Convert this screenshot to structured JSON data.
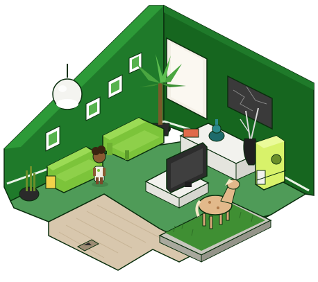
{
  "scene": {
    "type": "isometric-game-room",
    "theme": "green-walls-living-room",
    "colors": {
      "wall_left": "#1f7a2a",
      "wall_right": "#16661f",
      "wall_shadow": "#0f4d15",
      "wall_trim": "#2d9a38",
      "floor_carpet": "#4f9b58",
      "floor_wood": "#d8c7ad",
      "outline": "#0a2f0e",
      "sofa": "#7cc43a",
      "lamp": "#f4f4f0",
      "tv": "#2c2c2c",
      "cabinet_white": "#f2f2ee",
      "planter_grass": "#3f8f33",
      "pony": "#e2b98b",
      "fridge": "#d8f26a",
      "stairs_marker": "#9c8c74"
    },
    "objects": [
      {
        "name": "ceiling-lamp"
      },
      {
        "name": "wall-frame-1"
      },
      {
        "name": "wall-frame-2"
      },
      {
        "name": "wall-frame-3"
      },
      {
        "name": "wall-frame-4"
      },
      {
        "name": "palm-plant"
      },
      {
        "name": "wall-poster-white"
      },
      {
        "name": "wall-tv-screen"
      },
      {
        "name": "sofa-left"
      },
      {
        "name": "sofa-back"
      },
      {
        "name": "bamboo-plant"
      },
      {
        "name": "avatar"
      },
      {
        "name": "tv-stand"
      },
      {
        "name": "television"
      },
      {
        "name": "kettle"
      },
      {
        "name": "side-cabinet"
      },
      {
        "name": "vase-with-branches"
      },
      {
        "name": "green-fridge"
      },
      {
        "name": "pony-statue"
      },
      {
        "name": "grass-planter"
      },
      {
        "name": "door-arrow-tile"
      }
    ]
  }
}
